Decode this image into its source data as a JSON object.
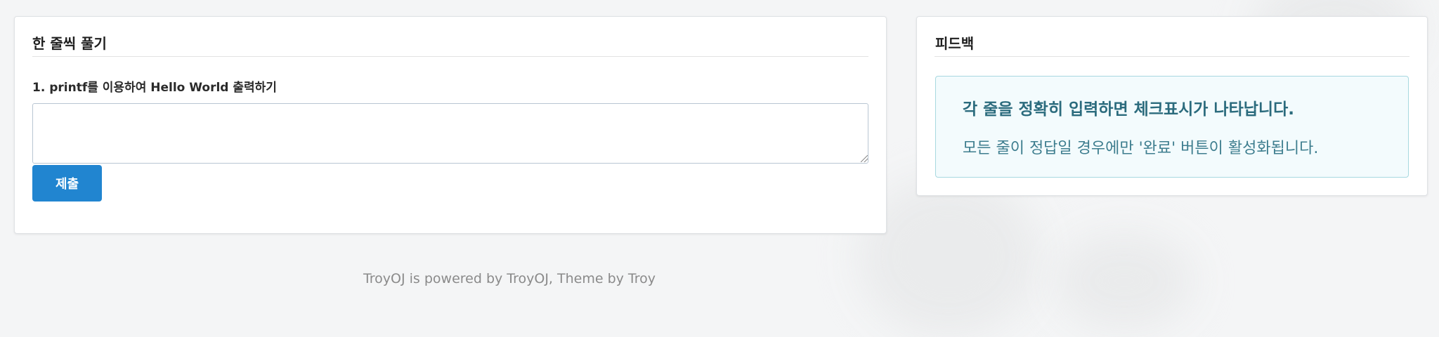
{
  "colors": {
    "background": "#f4f5f6",
    "card": "#ffffff",
    "primary_button": "#2185d0",
    "info_bg": "#f3fbfd",
    "info_border": "#a8d8e0",
    "info_text": "#2b6b7d",
    "footer_text": "#8a8a8a"
  },
  "left_card": {
    "title": "한 줄씩 풀기",
    "question": "1. printf를 이용하여 Hello World 출력하기",
    "answer_value": "",
    "answer_placeholder": "",
    "submit_label": "제출"
  },
  "right_card": {
    "title": "피드백",
    "info_title": "각 줄을 정확히 입력하면 체크표시가 나타납니다.",
    "info_text": "모든 줄이 정답일 경우에만 '완료' 버튼이 활성화됩니다."
  },
  "footer": {
    "text": "TroyOJ is powered by TroyOJ, Theme by Troy"
  }
}
